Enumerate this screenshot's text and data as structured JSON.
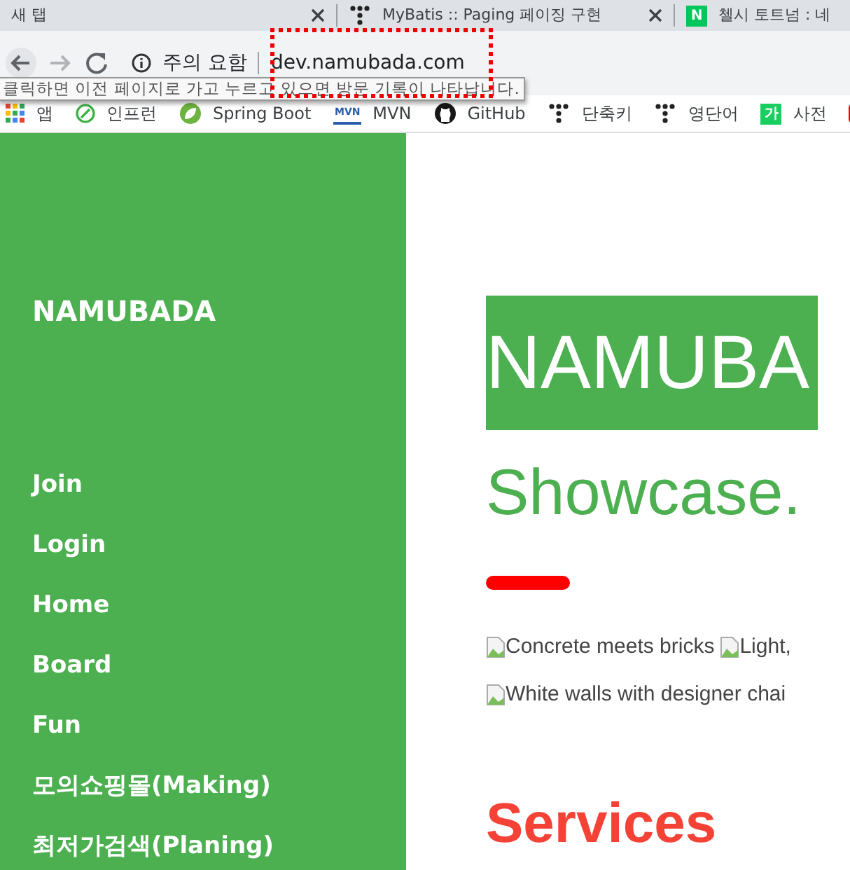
{
  "browser": {
    "tabs": [
      {
        "title": "새 탭",
        "kind": "plain"
      },
      {
        "title": "MyBatis :: Paging 페이징 구현",
        "kind": "dots"
      },
      {
        "title": "첼시 토트넘 : 네",
        "kind": "letter",
        "badge": "N"
      }
    ],
    "security_label": "주의 요함",
    "url": "dev.namubada.com",
    "tooltip": "클릭하면 이전 페이지로 가고 누르고 있으면 방문 기록이 나타납니다.",
    "bookmarks": [
      {
        "label": "앱",
        "kind": "apps"
      },
      {
        "label": "인프런",
        "kind": "leaf"
      },
      {
        "label": "Spring Boot",
        "kind": "spring"
      },
      {
        "label": "MVN",
        "kind": "text",
        "badge": "MVN"
      },
      {
        "label": "GitHub",
        "kind": "github"
      },
      {
        "label": "단축키",
        "kind": "dots"
      },
      {
        "label": "영단어",
        "kind": "dots"
      },
      {
        "label": "사전",
        "kind": "square",
        "badge": "가"
      },
      {
        "kind": "red"
      }
    ]
  },
  "sidebar": {
    "brand": "NAMUBADA",
    "items": [
      "Join",
      "Login",
      "Home",
      "Board",
      "Fun",
      "모의쇼핑몰(Making)",
      "최저가검색(Planing)"
    ]
  },
  "content": {
    "hero_title": "NAMUBA",
    "heading": "Showcase.",
    "image_rows": [
      [
        "Concrete meets bricks",
        "Light,"
      ],
      [
        "White walls with designer chai"
      ]
    ],
    "section_heading": "Services"
  }
}
